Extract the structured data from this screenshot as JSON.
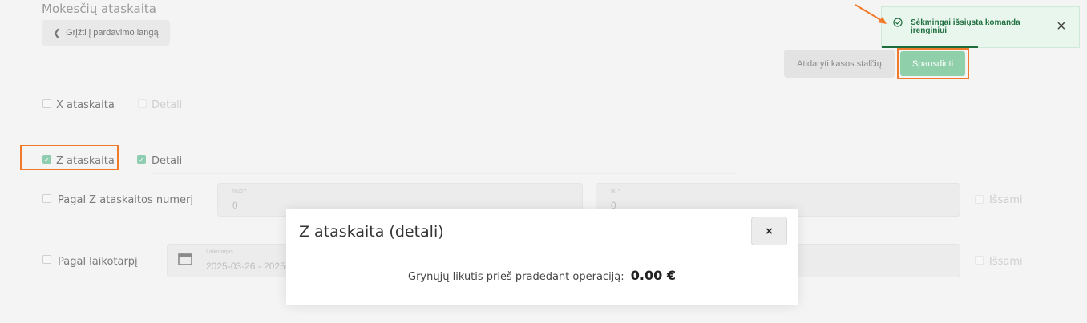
{
  "header": {
    "title": "Mokesčių ataskaita",
    "back_label": "Grįžti į pardavimo langą"
  },
  "actions": {
    "open_drawer_label": "Atidaryti kasos stalčių",
    "print_label": "Spausdinti"
  },
  "report_options": {
    "x_report": {
      "label": "X ataskaita",
      "checked": false,
      "detail_label": "Detali",
      "detail_checked": false
    },
    "z_report": {
      "label": "Z ataskaita",
      "checked": true,
      "detail_label": "Detali",
      "detail_checked": true
    }
  },
  "by_number": {
    "label": "Pagal Z ataskaitos numerį",
    "from_label": "Nuo *",
    "from_value": "0",
    "to_label": "Iki *",
    "to_value": "0",
    "full_label": "Išsami"
  },
  "by_period": {
    "label": "Pagal laikotarpį",
    "period_label": "Laikotarpis",
    "period_value": "2025-03-26 - 2025-",
    "full_label": "Išsami"
  },
  "modal": {
    "title": "Z ataskaita (detali)",
    "close_label": "×",
    "body_text": "Grynųjų likutis prieš pradedant operaciją:",
    "amount": "0.00 €"
  },
  "toast": {
    "message": "Sėkmingai išsiųsta komanda įrenginiui",
    "close_label": "×"
  },
  "colors": {
    "accent_green": "#8fd0ab",
    "toast_green": "#1f6f3f",
    "highlight_orange": "#f07a2a"
  }
}
